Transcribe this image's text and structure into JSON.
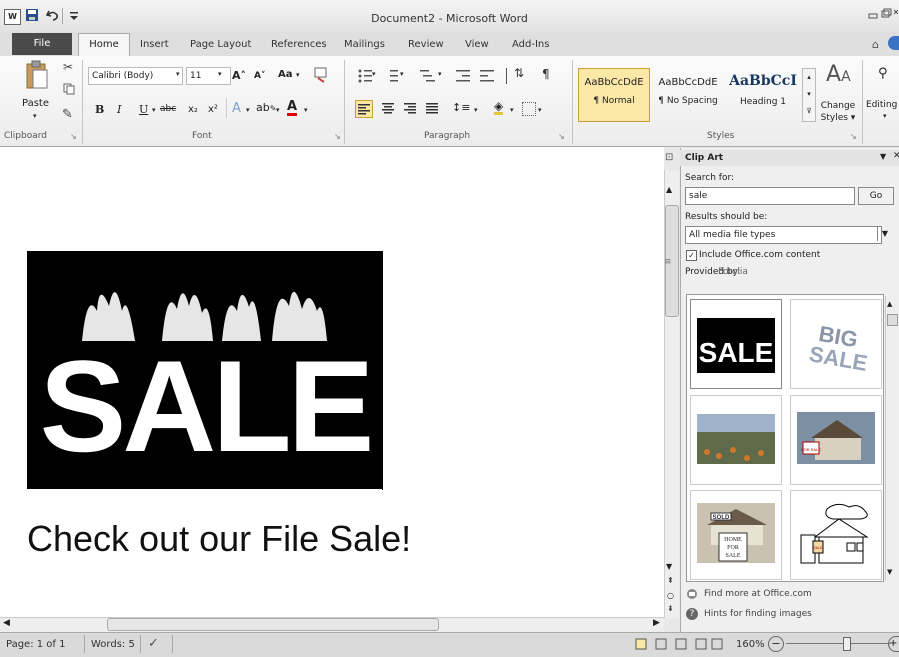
{
  "window": {
    "title": "Document2 - Microsoft Word",
    "logo": "W"
  },
  "quick_access": {
    "save_icon": "save-icon",
    "undo_icon": "undo-icon",
    "customize_icon": "customize-icon"
  },
  "tabs": [
    "File",
    "Home",
    "Insert",
    "Page Layout",
    "References",
    "Mailings",
    "Review",
    "View",
    "Add-Ins"
  ],
  "ribbon": {
    "clipboard": {
      "paste": "Paste",
      "label": "Clipboard"
    },
    "font": {
      "family": "Calibri (Body)",
      "size": "11",
      "label": "Font",
      "change_case": "Aa",
      "bold": "B",
      "italic": "I",
      "underline": "U",
      "strike": "abc",
      "sub": "x₂",
      "sup": "x²"
    },
    "paragraph": {
      "label": "Paragraph",
      "pilcrow": "¶"
    },
    "styles": {
      "label": "Styles",
      "items": [
        {
          "sample": "AaBbCcDdE",
          "name": "¶ Normal"
        },
        {
          "sample": "AaBbCcDdE",
          "name": "¶ No Spacing"
        },
        {
          "sample": "AaBbCcI",
          "name": "Heading 1"
        }
      ],
      "change_styles": "Change Styles",
      "change_styles_1": "Change",
      "change_styles_2": "Styles ▾"
    },
    "editing": "Editing"
  },
  "document": {
    "image_text": "SALE",
    "text": "Check out our File Sale!"
  },
  "clip_art": {
    "title": "Clip Art",
    "search_label": "Search for:",
    "search_value": "sale",
    "go": "Go",
    "results_label": "Results should be:",
    "media_type": "All media file types",
    "include_office": "Include Office.com content",
    "provided_by_label": "Provided by:",
    "provided_by": "Fotolia",
    "thumbs": [
      "SALE",
      "BIG SALE",
      "pumpkin field",
      "for sale house",
      "home for sale sign",
      "sold house clipart"
    ],
    "thumb_text": {
      "big": "BIG",
      "sale2": "SALE",
      "sold": "SOLD",
      "home": "HOME",
      "for": "FOR",
      "sale3": "SALE",
      "for_sale": "FOR SALE",
      "sale_small": "SALE"
    },
    "find_more": "Find more at Office.com",
    "hints": "Hints for finding images"
  },
  "status": {
    "page": "Page: 1 of 1",
    "words": "Words: 5",
    "zoom": "160%"
  }
}
